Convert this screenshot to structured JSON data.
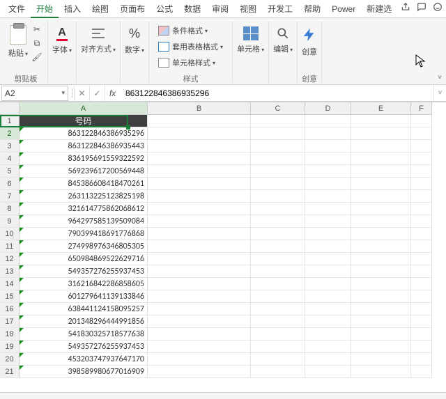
{
  "tabs": {
    "file": "文件",
    "home": "开始",
    "insert": "插入",
    "draw": "绘图",
    "page": "页面布",
    "formula": "公式",
    "data": "数据",
    "review": "审阅",
    "view": "视图",
    "dev": "开发工",
    "help": "帮助",
    "power": "Power",
    "new": "新建选"
  },
  "ribbon": {
    "clipboard": {
      "paste": "粘贴",
      "group": "剪贴板"
    },
    "font": {
      "label": "字体"
    },
    "align": {
      "label": "对齐方式"
    },
    "number": {
      "label": "数字"
    },
    "styles": {
      "cond": "条件格式",
      "table": "套用表格格式",
      "cell": "单元格样式",
      "group": "样式"
    },
    "cells": {
      "label": "单元格"
    },
    "editing": {
      "label": "编辑"
    },
    "creative": {
      "label": "创意",
      "group": "创意"
    }
  },
  "namebox": "A2",
  "formula": "863122846386935296",
  "columns": [
    "A",
    "B",
    "C",
    "D",
    "E",
    "F"
  ],
  "header_label": "号码",
  "row_count": 21,
  "values": [
    "863122846386935296",
    "863122846386935443",
    "836195691559322592",
    "569239617200569448",
    "845386608418470261",
    "263113225123825198",
    "321614775862068612",
    "964297585139509084",
    "790399418691776868",
    "274998976346805305",
    "650984869522629716",
    "549357276255937453",
    "316216842286858605",
    "601279641139133846",
    "638441124158095257",
    "201348296444991856",
    "541830325718577638",
    "549357276255937453",
    "453203747937647170",
    "398589980677016909"
  ]
}
